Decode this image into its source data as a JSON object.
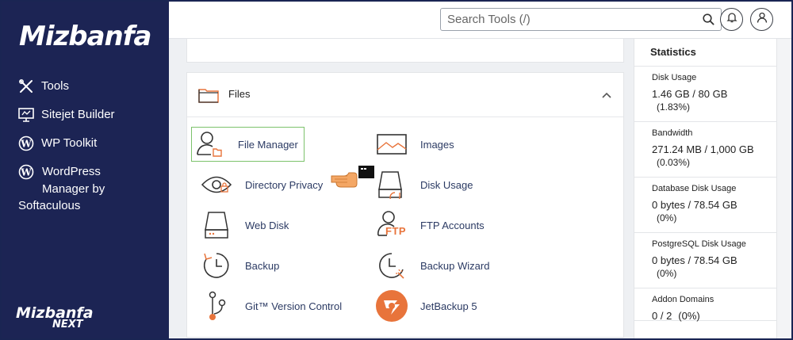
{
  "brand": {
    "logo": "Mizbanfa",
    "footer_logo_main": "Mizbanfa",
    "footer_logo_sub": "NEXT"
  },
  "sidebar": {
    "items": [
      {
        "label": "Tools",
        "icon": "tools-icon"
      },
      {
        "label": "Sitejet Builder",
        "icon": "monitor-icon"
      },
      {
        "label": "WP Toolkit",
        "icon": "wordpress-icon"
      },
      {
        "label": "WordPress Manager by Softaculous",
        "line1": "WordPress",
        "line2": "Manager by",
        "line3": "Softaculous",
        "icon": "wordpress-icon"
      }
    ]
  },
  "header": {
    "search_placeholder": "Search Tools (/)"
  },
  "files": {
    "title": "Files",
    "tools": [
      {
        "label": "File Manager",
        "icon": "file-manager-icon",
        "selected": true
      },
      {
        "label": "Images",
        "icon": "images-icon"
      },
      {
        "label": "Directory Privacy",
        "icon": "eye-icon"
      },
      {
        "label": "Disk Usage",
        "icon": "disk-usage-icon"
      },
      {
        "label": "Web Disk",
        "icon": "web-disk-icon"
      },
      {
        "label": "FTP Accounts",
        "icon": "ftp-accounts-icon",
        "badge": "FTP"
      },
      {
        "label": "Backup",
        "icon": "backup-icon"
      },
      {
        "label": "Backup Wizard",
        "icon": "backup-wizard-icon"
      },
      {
        "label": "Git™ Version Control",
        "icon": "git-icon"
      },
      {
        "label": "JetBackup 5",
        "icon": "jetbackup-icon"
      }
    ]
  },
  "statistics": {
    "title": "Statistics",
    "items": [
      {
        "label": "Disk Usage",
        "value": "1.46 GB / 80 GB",
        "percent": "(1.83%)"
      },
      {
        "label": "Bandwidth",
        "value": "271.24 MB / 1,000 GB",
        "percent": "(0.03%)"
      },
      {
        "label": "Database Disk Usage",
        "value": "0 bytes / 78.54 GB",
        "percent": "(0%)"
      },
      {
        "label": "PostgreSQL Disk Usage",
        "value": "0 bytes / 78.54 GB",
        "percent": "(0%)"
      },
      {
        "label": "Addon Domains",
        "value": "0 / 2",
        "percent": "(0%)"
      }
    ]
  },
  "colors": {
    "sidebar": "#1c2454",
    "accent_orange": "#e8743b",
    "selected_border": "#7cc26b",
    "link": "#2b3a63"
  }
}
